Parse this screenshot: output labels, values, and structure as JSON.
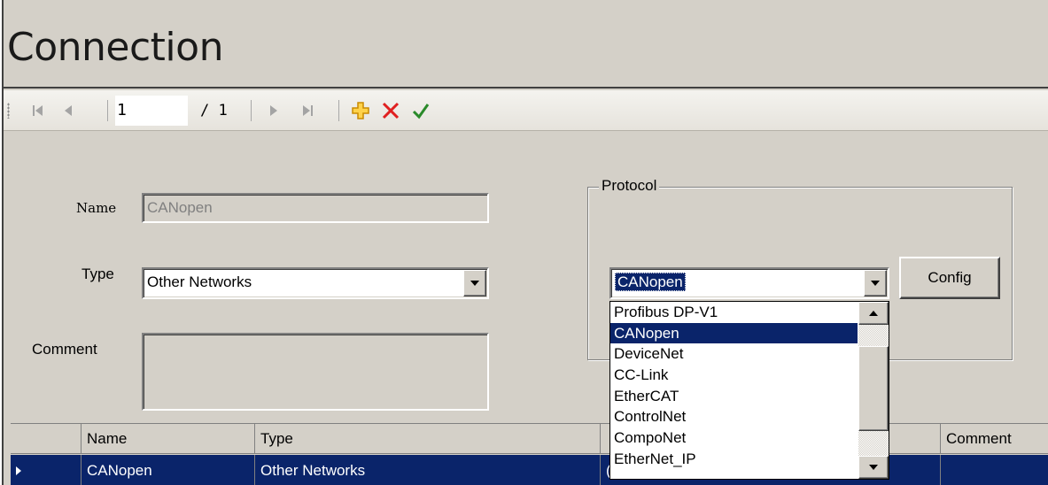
{
  "window": {
    "title": "Connection"
  },
  "navigator": {
    "position_value": "1",
    "position_of": "/ 1",
    "icons": [
      "move-first-icon",
      "move-previous-icon",
      "move-next-icon",
      "move-last-icon",
      "add-new-icon",
      "delete-icon",
      "save-icon"
    ]
  },
  "form": {
    "name_label": "Name",
    "name_value": "CANopen",
    "type_label": "Type",
    "type_value": "Other Networks",
    "comment_label": "Comment",
    "comment_value": "",
    "protocol": {
      "legend": "Protocol",
      "selected": "CANopen",
      "config_label": "Config",
      "options": [
        "Profibus DP-V1",
        "CANopen",
        "DeviceNet",
        "CC-Link",
        "EtherCAT",
        "ControlNet",
        "CompoNet",
        "EtherNet_IP"
      ]
    }
  },
  "grid": {
    "columns": [
      "",
      "Name",
      "Type",
      "",
      "Comment"
    ],
    "rows": [
      {
        "name": "CANopen",
        "type": "Other Networks",
        "protocol": "(",
        "comment": ""
      }
    ]
  },
  "colors": {
    "face": "#d4d0c8",
    "selection": "#0a246a",
    "add_icon": "#f2a900",
    "delete_icon": "#e02020",
    "save_icon": "#2a8a2a"
  }
}
